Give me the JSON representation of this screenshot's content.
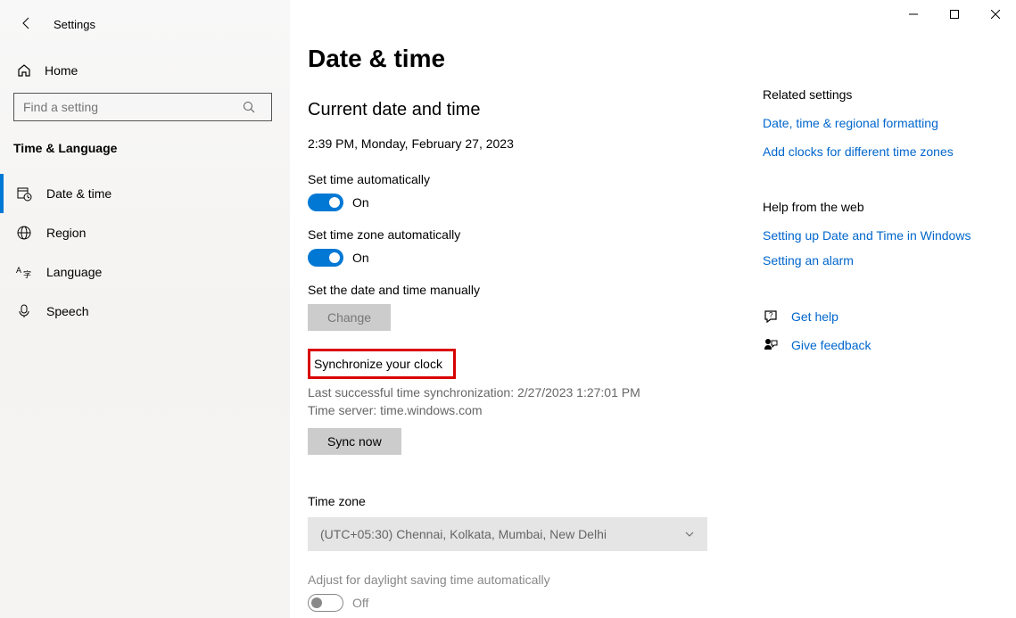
{
  "window": {
    "title": "Settings"
  },
  "sidebar": {
    "home_label": "Home",
    "search_placeholder": "Find a setting",
    "category": "Time & Language",
    "items": [
      {
        "label": "Date & time"
      },
      {
        "label": "Region"
      },
      {
        "label": "Language"
      },
      {
        "label": "Speech"
      }
    ]
  },
  "main": {
    "heading": "Date & time",
    "current_heading": "Current date and time",
    "current_time": "2:39 PM, Monday, February 27, 2023",
    "set_time_auto_label": "Set time automatically",
    "set_time_auto_state": "On",
    "set_zone_auto_label": "Set time zone automatically",
    "set_zone_auto_state": "On",
    "manual_label": "Set the date and time manually",
    "change_btn": "Change",
    "sync_heading": "Synchronize your clock",
    "sync_last": "Last successful time synchronization: 2/27/2023 1:27:01 PM",
    "sync_server": "Time server: time.windows.com",
    "sync_btn": "Sync now",
    "timezone_label": "Time zone",
    "timezone_value": "(UTC+05:30) Chennai, Kolkata, Mumbai, New Delhi",
    "dst_label": "Adjust for daylight saving time automatically",
    "dst_state": "Off"
  },
  "right": {
    "related_heading": "Related settings",
    "link_formatting": "Date, time & regional formatting",
    "link_clocks": "Add clocks for different time zones",
    "help_heading": "Help from the web",
    "link_setting_up": "Setting up Date and Time in Windows",
    "link_alarm": "Setting an alarm",
    "get_help": "Get help",
    "give_feedback": "Give feedback"
  }
}
